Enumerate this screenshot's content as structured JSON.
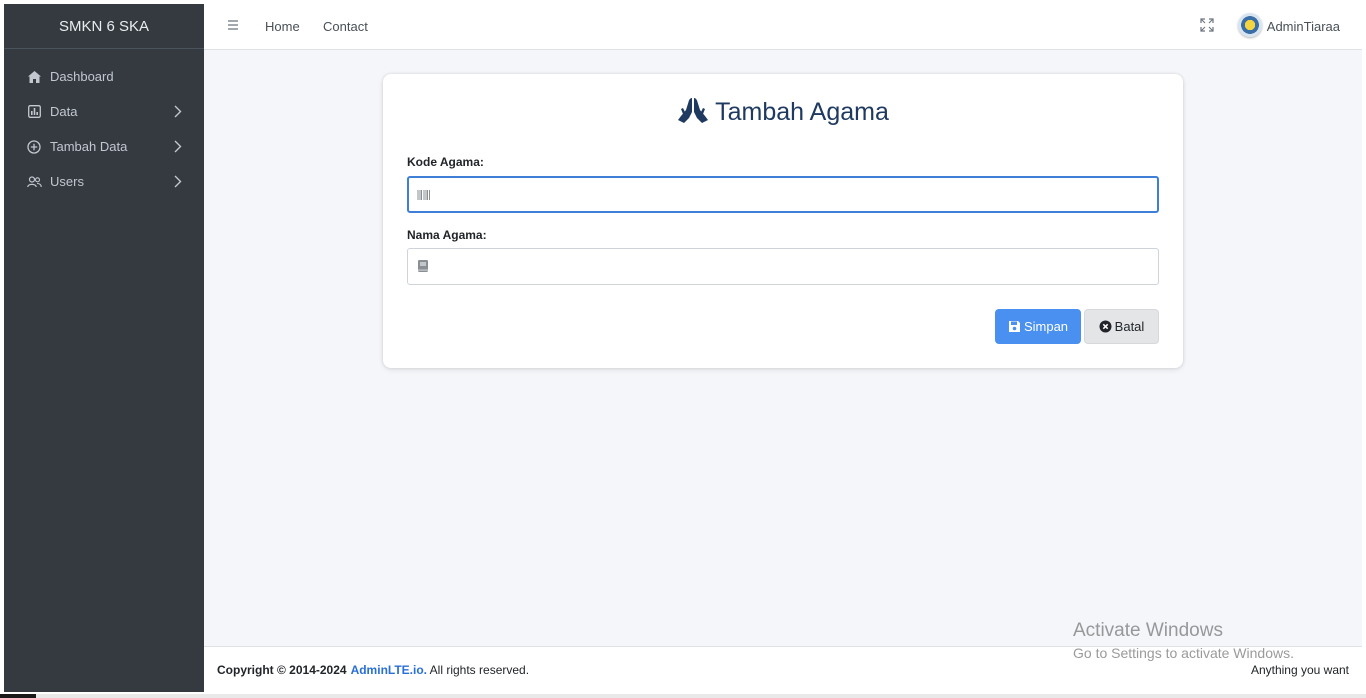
{
  "sidebar": {
    "brand": "SMKN 6 SKA",
    "items": [
      {
        "label": "Dashboard",
        "icon": "home-icon",
        "has_children": false
      },
      {
        "label": "Data",
        "icon": "chart-icon",
        "has_children": true
      },
      {
        "label": "Tambah Data",
        "icon": "plus-circle-icon",
        "has_children": true
      },
      {
        "label": "Users",
        "icon": "users-icon",
        "has_children": true
      }
    ]
  },
  "topbar": {
    "links": [
      "Home",
      "Contact"
    ],
    "user_name": "AdminTiaraa"
  },
  "form": {
    "title": "Tambah Agama",
    "title_icon": "praying-hands-icon",
    "fields": [
      {
        "label": "Kode Agama:",
        "value": "",
        "icon": "barcode-icon",
        "focused": true
      },
      {
        "label": "Nama Agama:",
        "value": "",
        "icon": "book-icon",
        "focused": false
      }
    ],
    "save_label": "Simpan",
    "cancel_label": "Batal"
  },
  "footer": {
    "copyright_prefix": "Copyright © 2014-2024",
    "link_text": "AdminLTE.io.",
    "suffix": "All rights reserved.",
    "right_text": "Anything you want"
  },
  "watermark": {
    "line1": "Activate Windows",
    "line2": "Go to Settings to activate Windows."
  },
  "colors": {
    "sidebar_bg": "#343a40",
    "primary": "#4a90f0",
    "title": "#1f3a60",
    "link": "#2a6fd6"
  }
}
